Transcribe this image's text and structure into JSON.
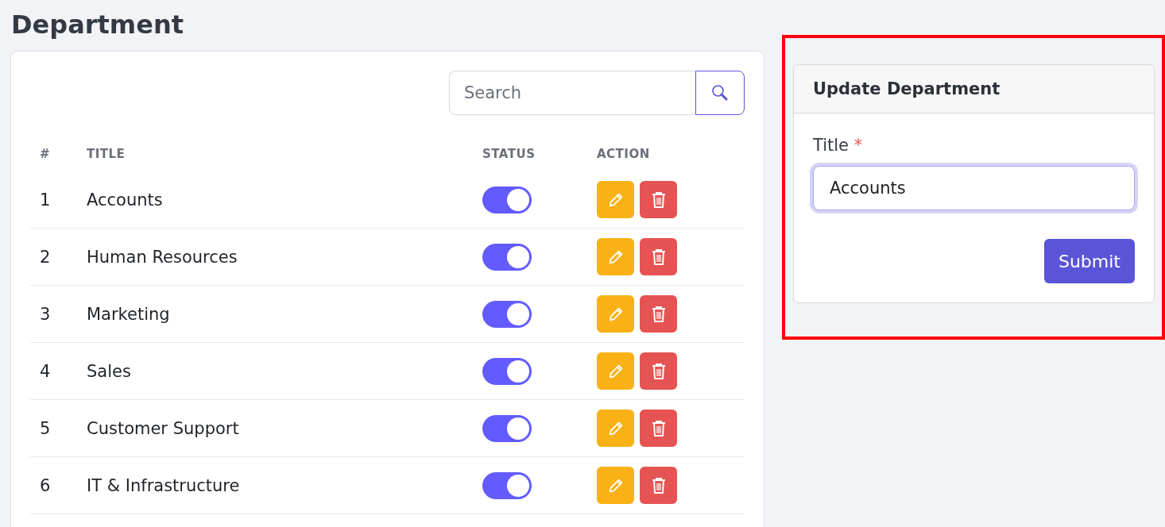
{
  "page_title": "Department",
  "search": {
    "placeholder": "Search"
  },
  "table": {
    "columns": [
      "#",
      "TITLE",
      "STATUS",
      "ACTION"
    ],
    "rows": [
      {
        "number": "1",
        "title": "Accounts",
        "on": true
      },
      {
        "number": "2",
        "title": "Human Resources",
        "on": true
      },
      {
        "number": "3",
        "title": "Marketing",
        "on": true
      },
      {
        "number": "4",
        "title": "Sales",
        "on": true
      },
      {
        "number": "5",
        "title": "Customer Support",
        "on": true
      },
      {
        "number": "6",
        "title": "IT & Infrastructure",
        "on": true
      }
    ]
  },
  "form": {
    "title": "Update Department",
    "field_label": "Title",
    "required_mark": "*",
    "value": "Accounts",
    "submit": "Submit"
  }
}
